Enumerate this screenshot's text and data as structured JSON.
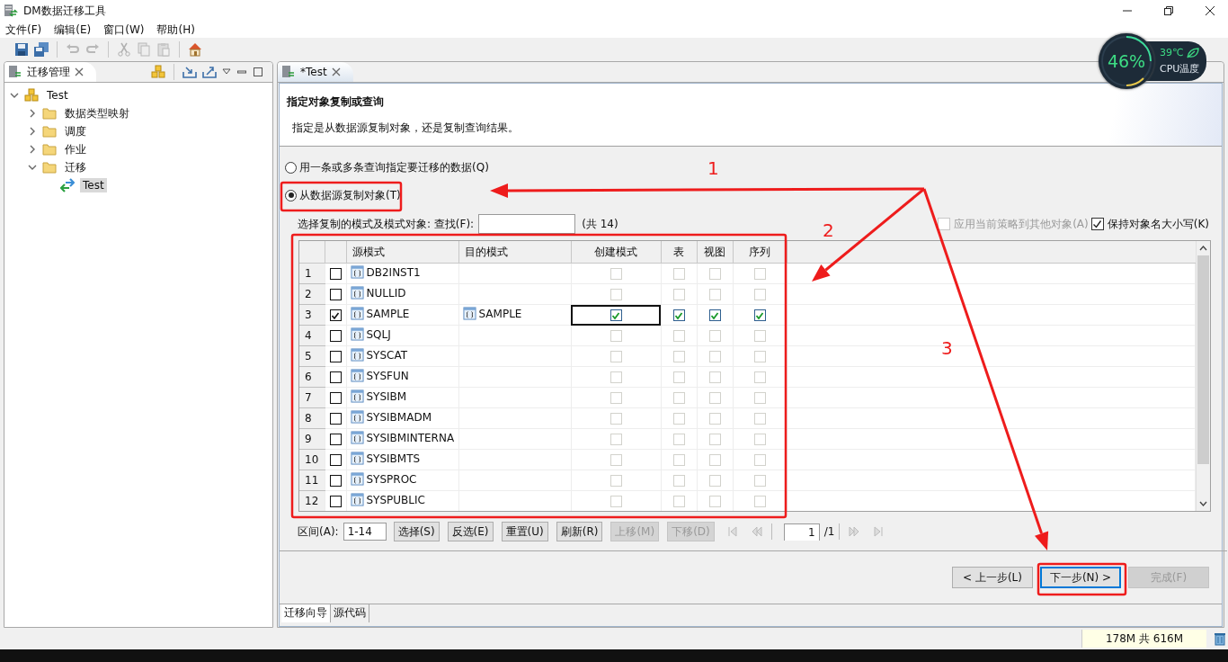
{
  "window": {
    "title": "DM数据迁移工具"
  },
  "menu": [
    "文件(F)",
    "编辑(E)",
    "窗口(W)",
    "帮助(H)"
  ],
  "left_panel": {
    "tab": "迁移管理",
    "tree": [
      {
        "label": "Test",
        "kind": "project",
        "expanded": true,
        "selected": false,
        "children": [
          {
            "label": "数据类型映射",
            "kind": "folder",
            "expanded": false,
            "selected": false
          },
          {
            "label": "调度",
            "kind": "folder",
            "expanded": false,
            "selected": false
          },
          {
            "label": "作业",
            "kind": "folder",
            "expanded": false,
            "selected": false
          },
          {
            "label": "迁移",
            "kind": "folder",
            "expanded": true,
            "selected": false,
            "children": [
              {
                "label": "Test",
                "kind": "migration",
                "selected": true
              }
            ]
          }
        ]
      }
    ]
  },
  "editor": {
    "tab": "*Test",
    "page": {
      "title": "指定对象复制或查询",
      "description": "指定是从数据源复制对象，还是复制查询结果。"
    },
    "options": [
      {
        "label": "用一条或多条查询指定要迁移的数据(Q)",
        "selected": false
      },
      {
        "label": "从数据源复制对象(T)",
        "selected": true
      }
    ],
    "search": {
      "label": "选择复制的模式及模式对象: 查找(F):",
      "count": "(共 14)"
    },
    "checkboxes": [
      {
        "label": "应用当前策略到其他对象(A)",
        "checked": false,
        "disabled": true
      },
      {
        "label": "保持对象名大小写(K)",
        "checked": true,
        "disabled": false
      }
    ],
    "table": {
      "columns": [
        "源模式",
        "目的模式",
        "创建模式",
        "表",
        "视图",
        "序列"
      ],
      "rows": [
        {
          "num": "1",
          "checked": false,
          "source": "DB2INST1",
          "create": false,
          "create_focused": false,
          "table": false,
          "view": false,
          "sequence": false
        },
        {
          "num": "2",
          "checked": false,
          "source": "NULLID",
          "create": false,
          "create_focused": false,
          "table": false,
          "view": false,
          "sequence": false
        },
        {
          "num": "3",
          "checked": true,
          "source": "SAMPLE",
          "target": "SAMPLE",
          "create": true,
          "create_focused": true,
          "table": true,
          "view": true,
          "sequence": true
        },
        {
          "num": "4",
          "checked": false,
          "source": "SQLJ",
          "create": false,
          "create_focused": false,
          "table": false,
          "view": false,
          "sequence": false
        },
        {
          "num": "5",
          "checked": false,
          "source": "SYSCAT",
          "create": false,
          "create_focused": false,
          "table": false,
          "view": false,
          "sequence": false
        },
        {
          "num": "6",
          "checked": false,
          "source": "SYSFUN",
          "create": false,
          "create_focused": false,
          "table": false,
          "view": false,
          "sequence": false
        },
        {
          "num": "7",
          "checked": false,
          "source": "SYSIBM",
          "create": false,
          "create_focused": false,
          "table": false,
          "view": false,
          "sequence": false
        },
        {
          "num": "8",
          "checked": false,
          "source": "SYSIBMADM",
          "create": false,
          "create_focused": false,
          "table": false,
          "view": false,
          "sequence": false
        },
        {
          "num": "9",
          "checked": false,
          "source": "SYSIBMINTERNA",
          "create": false,
          "create_focused": false,
          "table": false,
          "view": false,
          "sequence": false
        },
        {
          "num": "10",
          "checked": false,
          "source": "SYSIBMTS",
          "create": false,
          "create_focused": false,
          "table": false,
          "view": false,
          "sequence": false
        },
        {
          "num": "11",
          "checked": false,
          "source": "SYSPROC",
          "create": false,
          "create_focused": false,
          "table": false,
          "view": false,
          "sequence": false
        },
        {
          "num": "12",
          "checked": false,
          "source": "SYSPUBLIC",
          "create": false,
          "create_focused": false,
          "table": false,
          "view": false,
          "sequence": false
        }
      ]
    },
    "range": {
      "label": "区间(A):",
      "value": "1-14"
    },
    "buttons": [
      {
        "label": "选择(S)",
        "disabled": false
      },
      {
        "label": "反选(E)",
        "disabled": false
      },
      {
        "label": "重置(U)",
        "disabled": false
      },
      {
        "label": "刷新(R)",
        "disabled": false
      },
      {
        "label": "上移(M)",
        "disabled": true
      },
      {
        "label": "下移(D)",
        "disabled": true
      }
    ],
    "pager": {
      "page": "1",
      "total": "/1"
    },
    "wizard_buttons": [
      {
        "label": "< 上一步(L)",
        "disabled": false,
        "focused": false
      },
      {
        "label": "下一步(N) >",
        "disabled": false,
        "focused": true
      },
      {
        "label": "完成(F)",
        "disabled": true,
        "focused": false
      }
    ],
    "bottom_tabs": [
      {
        "label": "迁移向导",
        "selected": true
      },
      {
        "label": "源代码",
        "selected": false
      }
    ]
  },
  "status_bar": {
    "memory": "178M 共 616M"
  },
  "cpu_widget": {
    "usage": "46%",
    "temperature": "39℃",
    "label": "CPU温度"
  },
  "annotations": [
    {
      "label": "1"
    },
    {
      "label": "2"
    },
    {
      "label": "3"
    }
  ]
}
